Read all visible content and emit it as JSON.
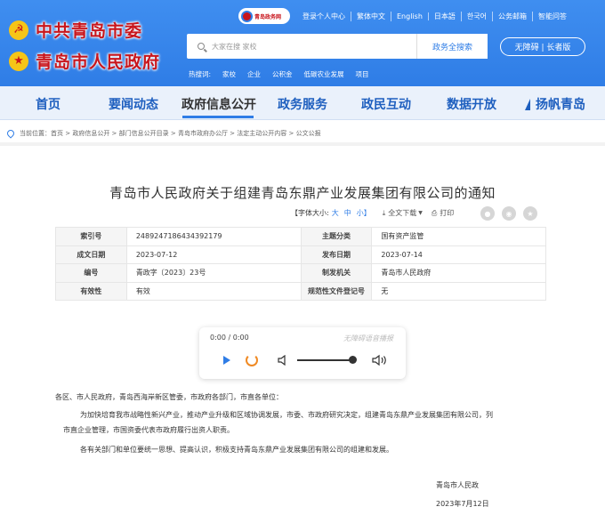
{
  "header": {
    "logo_top": "中共青岛市委",
    "logo_bottom": "青岛市人民政府",
    "site_badge": "青岛政务网",
    "top_links": [
      "登录个人中心",
      "繁体中文",
      "English",
      "日本語",
      "한국어",
      "公务邮箱",
      "智能问答"
    ],
    "search_placeholder": "大家在搜 家校",
    "search_button": "政务全搜索",
    "access_button": "无障碍 | 长者版",
    "hot_label": "热搜词:",
    "hot_terms": [
      "家校",
      "企业",
      "公积金",
      "低碳农业发展",
      "项目"
    ]
  },
  "nav": {
    "items": [
      "首页",
      "要闻动态",
      "政府信息公开",
      "政务服务",
      "政民互动",
      "数据开放",
      "扬帆青岛"
    ],
    "active_index": 2
  },
  "breadcrumb": "当前位置：首页 > 政府信息公开 > 部门信息公开目录 > 青岛市政府办公厅 > 法定主动公开内容 > 公文公报",
  "article": {
    "title": "青岛市人民政府关于组建青岛东鼎产业发展集团有限公司的通知",
    "font_size_label": "【字体大小:",
    "font_sizes": [
      "大",
      "中",
      "小】"
    ],
    "download_label": "全文下载",
    "print_label": "打印",
    "info": {
      "index_no_key": "索引号",
      "index_no": "2489247186434392179",
      "topic_key": "主题分类",
      "topic": "国有资产监管",
      "created_key": "成文日期",
      "created": "2023-07-12",
      "published_key": "发布日期",
      "published": "2023-07-14",
      "doc_no_key": "编号",
      "doc_no": "青政字〔2023〕23号",
      "issuer_key": "制发机关",
      "issuer": "青岛市人民政府",
      "valid_key": "有效性",
      "valid": "有效",
      "reg_key": "规范性文件登记号",
      "reg": "无"
    },
    "audio": {
      "time": "0:00 / 0:00",
      "tag": "无障碍语音播报"
    },
    "salutation": "各区、市人民政府，青岛西海岸新区管委，市政府各部门，市直各单位：",
    "para1": "为加快培育我市战略性新兴产业，推动产业升级和区域协调发展，市委、市政府研究决定，组建青岛东鼎产业发展集团有限公司，列",
    "para1_cont": "市直企业管理，市国资委代表市政府履行出资人职责。",
    "para2": "各有关部门和单位要统一思想、提高认识，积极支持青岛东鼎产业发展集团有限公司的组建和发展。",
    "sign_org": "青岛市人民政",
    "sign_date": "2023年7月12日"
  }
}
